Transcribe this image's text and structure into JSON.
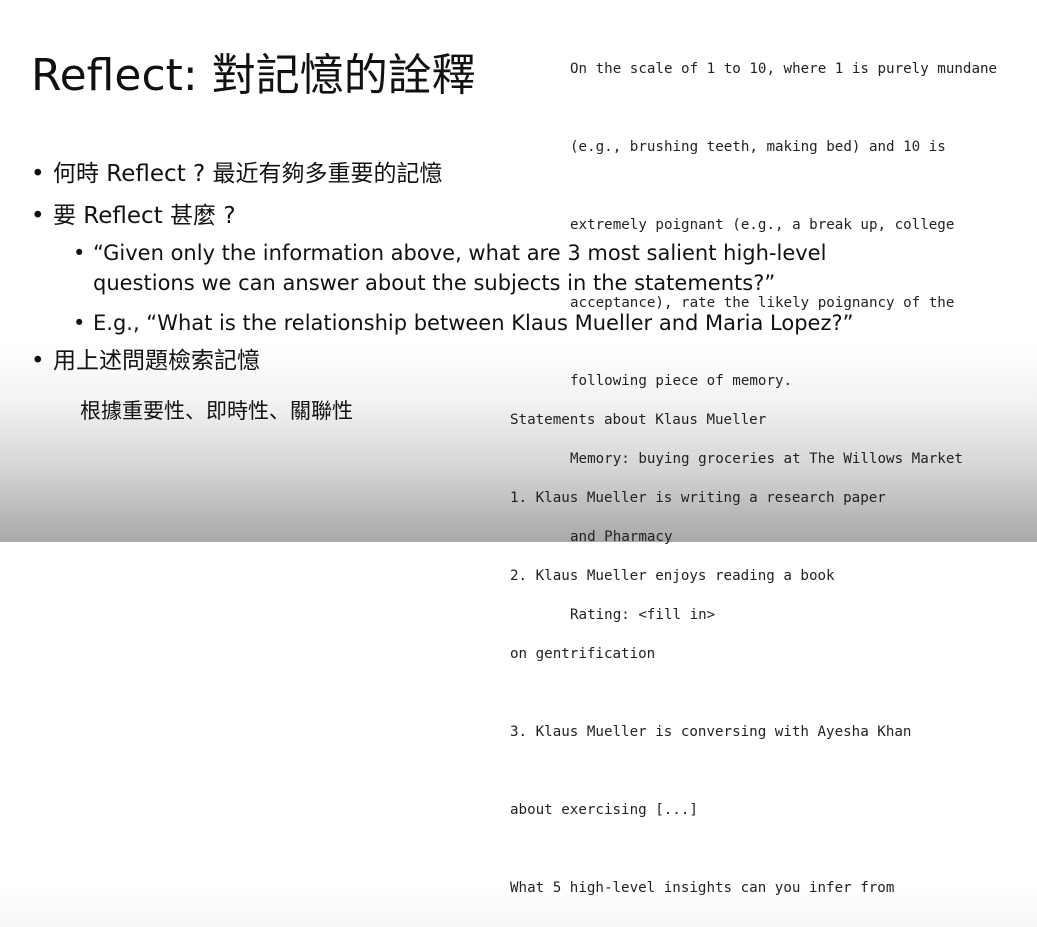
{
  "slide": {
    "title": "Reflect: 對記憶的詮釋",
    "bullets": {
      "when": "何時 Reflect ? 最近有夠多重要的記憶",
      "what": "要 Reflect 甚麼 ?",
      "sub1_line1": "“Given only the information above, what are 3 most salient high-level",
      "sub1_line2": "questions we can answer about the subjects in the statements?”",
      "sub2": "E.g., “What is the relationship between Klaus Mueller and Maria Lopez?”",
      "retrieve": "用上述問題檢索記憶",
      "criteria": "根據重要性、即時性、關聯性"
    },
    "bullet_symbol": "•"
  },
  "prompt_box": {
    "lines": [
      "On the scale of 1 to 10, where 1 is purely mundane",
      "(e.g., brushing teeth, making bed) and 10 is",
      "extremely poignant (e.g., a break up, college",
      "acceptance), rate the likely poignancy of the",
      "following piece of memory.",
      "Memory: buying groceries at The Willows Market",
      "and Pharmacy",
      "Rating: <fill in>"
    ]
  },
  "statements_box": {
    "lines": [
      "Statements about Klaus Mueller",
      "1. Klaus Mueller is writing a research paper",
      "2. Klaus Mueller enjoys reading a book",
      "on gentrification",
      "3. Klaus Mueller is conversing with Ayesha Khan",
      "about exercising [...]",
      "What 5 high-level insights can you infer from"
    ]
  }
}
